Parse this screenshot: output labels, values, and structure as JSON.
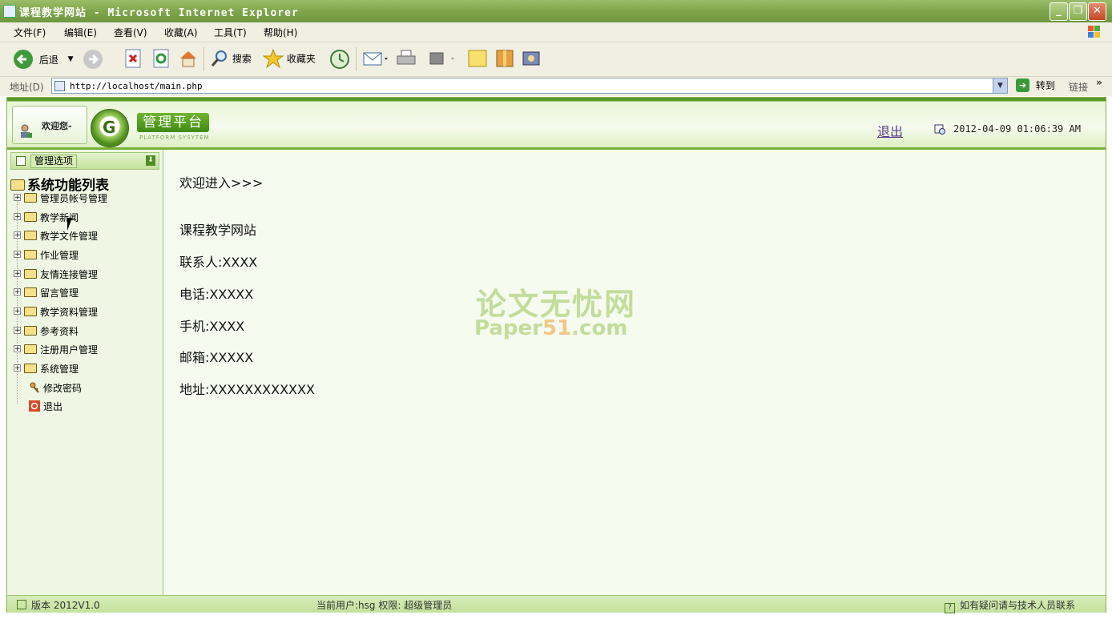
{
  "window": {
    "title": "课程教学网站 - Microsoft Internet Explorer",
    "buttons": {
      "minimize": "_",
      "restore": "❐",
      "close": "✕"
    }
  },
  "menu": [
    "文件(F)",
    "编辑(E)",
    "查看(V)",
    "收藏(A)",
    "工具(T)",
    "帮助(H)"
  ],
  "toolbar": {
    "back_label": "后退",
    "search_label": "搜索",
    "favorites_label": "收藏夹"
  },
  "address": {
    "label": "地址(D)",
    "url": "http://localhost/main.php",
    "go_label": "转到",
    "links_label": "链接"
  },
  "header": {
    "welcome": "欢迎您-",
    "logo_title": "管理平台",
    "logo_subtitle": "PLATFORM SYSYTEM",
    "logout": "退出",
    "datetime": "2012-04-09 01:06:39 AM"
  },
  "sidebar": {
    "header_label": "管理选项",
    "root": "系统功能列表",
    "items": [
      {
        "label": "管理员帐号管理",
        "icon": "folder-icon"
      },
      {
        "label": "教学新闻",
        "icon": "folder-icon"
      },
      {
        "label": "教学文件管理",
        "icon": "folder-icon"
      },
      {
        "label": "作业管理",
        "icon": "folder-icon"
      },
      {
        "label": "友情连接管理",
        "icon": "folder-icon"
      },
      {
        "label": "留言管理",
        "icon": "folder-icon"
      },
      {
        "label": "教学资料管理",
        "icon": "folder-icon"
      },
      {
        "label": "参考资料",
        "icon": "folder-icon"
      },
      {
        "label": "注册用户管理",
        "icon": "folder-icon"
      },
      {
        "label": "系统管理",
        "icon": "folder-icon"
      },
      {
        "label": "修改密码",
        "icon": "key-icon"
      },
      {
        "label": "退出",
        "icon": "exit-icon"
      }
    ]
  },
  "main": {
    "welcome": "欢迎进入>>>",
    "site_name": "课程教学网站",
    "contact": "联系人:XXXX",
    "phone": "电话:XXXXX",
    "mobile": "手机:XXXX",
    "email": "邮箱:XXXXX",
    "address": "地址:XXXXXXXXXXXX",
    "watermark_cn": "论文无忧网",
    "watermark_en_a": "Paper",
    "watermark_en_b": "51",
    "watermark_en_c": ".com"
  },
  "footer": {
    "version": "版本 2012V1.0",
    "current_user": "当前用户:hsg 权限: 超级管理员",
    "help": "如有疑问请与技术人员联系"
  }
}
